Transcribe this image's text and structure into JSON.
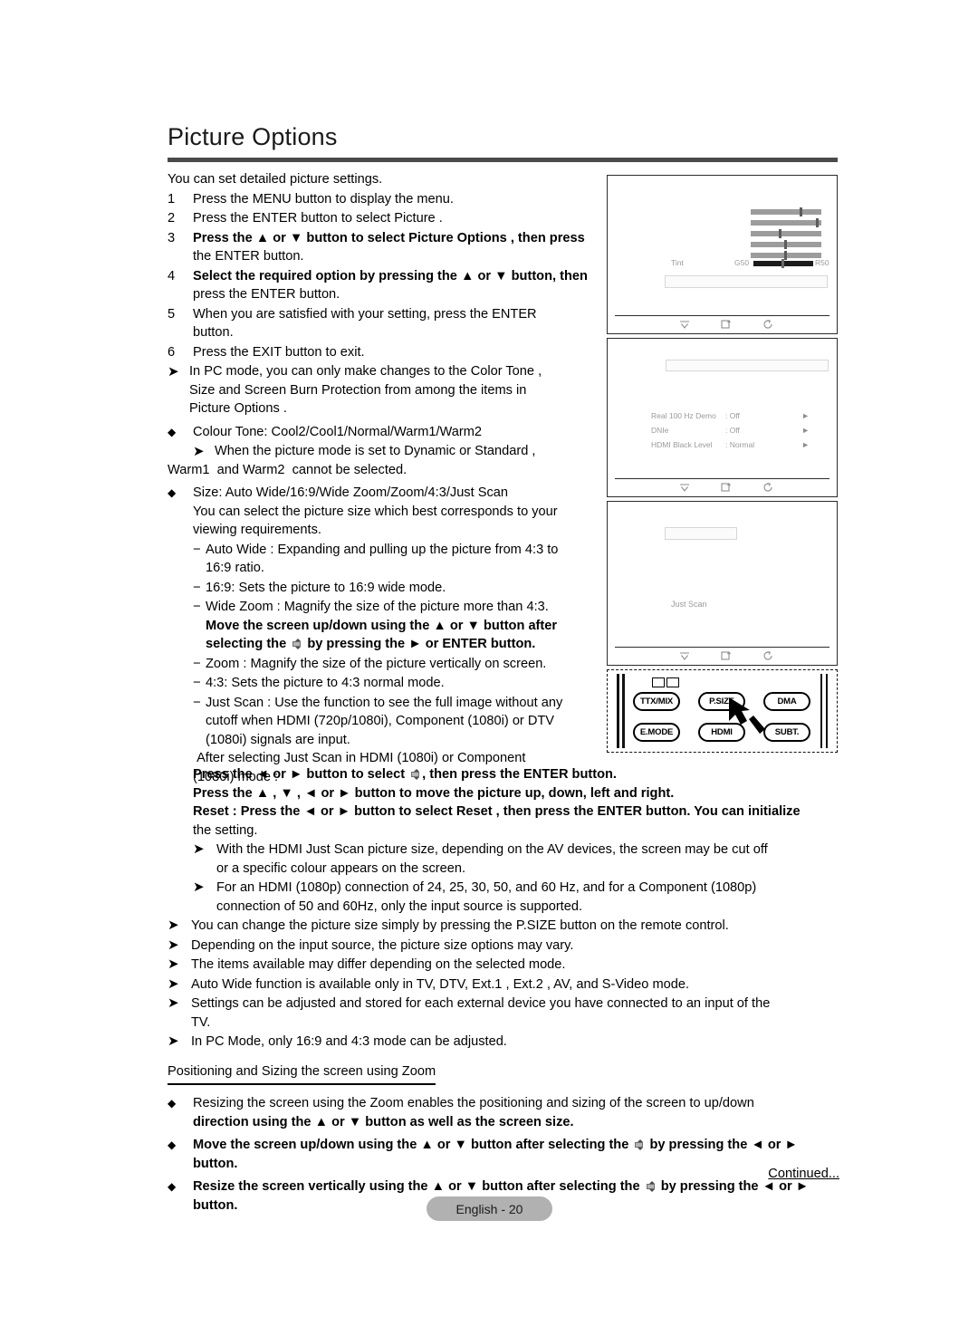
{
  "document": {
    "title": "Picture Options",
    "intro": "You can set detailed picture settings.",
    "footer_label": "English - 20",
    "continued_label": "Continued..."
  },
  "steps": [
    {
      "num": "1",
      "text": "Press the MENU button to display the menu.",
      "bold": false
    },
    {
      "num": "2",
      "text": "Press the ENTER button to select Picture .",
      "bold": false
    },
    {
      "num": "3",
      "text": "Press the ▲ or ▼ button to select Picture Options  , then press",
      "text2": "the ENTER button.",
      "bold": true
    },
    {
      "num": "4",
      "text": "Select the required option by pressing the ▲ or ▼ button, then",
      "text2": "press the ENTER button.",
      "bold": true
    },
    {
      "num": "5",
      "text": "When you are satisfied with your setting, press the ENTER",
      "text2": "button.",
      "bold": false
    },
    {
      "num": "6",
      "text": "Press the EXIT button to exit.",
      "bold": false
    }
  ],
  "notes_top": [
    "In PC mode, you can only make changes to the Color Tone ,",
    "Size and Screen Burn Protection    from among the items in",
    "Picture Options  ."
  ],
  "colour_tone": {
    "bullet": "Colour Tone: Cool2/Cool1/Normal/Warm1/Warm2",
    "note_line1": "When the picture mode is set to Dynamic  or Standard ,",
    "note_line2": "Warm1  and Warm2  cannot be selected."
  },
  "size_section": {
    "bullet": "Size: Auto Wide/16:9/Wide Zoom/Zoom/4:3/Just Scan",
    "desc1": "You can select the picture size which best corresponds to your",
    "desc2": "viewing requirements.",
    "items": [
      {
        "label": "Auto Wide : Expanding and pulling up the picture from 4:3 to",
        "cont": [
          "16:9 ratio."
        ],
        "bold": false
      },
      {
        "label": "16:9: Sets the picture to 16:9 wide mode.",
        "cont": [],
        "bold": false
      },
      {
        "label": "Wide Zoom : Magnify the size of the picture more than 4:3.",
        "cont": [],
        "bold": false
      },
      {
        "label": "Zoom : Magnify the size of the picture vertically on screen.",
        "cont": [],
        "bold": false
      },
      {
        "label": "4:3: Sets the picture to 4:3 normal mode.",
        "cont": [],
        "bold": false
      },
      {
        "label": "Just Scan : Use the function to see the full image without any",
        "cont": [
          "cutoff when HDMI (720p/1080i), Component (1080i) or DTV",
          "(1080i) signals are input."
        ],
        "bold": false
      }
    ],
    "wide_zoom_extra_1": "Move the screen up/down using the ▲ or ▼ button after",
    "wide_zoom_extra_2a": "selecting the ",
    "wide_zoom_extra_2b": " by pressing the ► or ENTER button.",
    "after_just_scan_1": " After selecting Just Scan in HDMI (1080i) or Component",
    "after_just_scan_2": "(1080i) mode :"
  },
  "press_block": {
    "line1a": "Press the ◄ or ► button to select ",
    "line1b": ", then press the ENTER button.",
    "line2": "Press the ▲ , ▼ , ◄ or ► button to move the picture up, down, left and right.",
    "line3a": "Reset : Press the ◄ or ► button to select Reset , then press the ENTER button. You can initialize",
    "line3b": "the setting."
  },
  "notes_mid": [
    {
      "l1": "With the HDMI Just Scan picture size, depending on the AV devices, the screen may be cut off",
      "l2": "or a specific colour appears on the screen."
    },
    {
      "l1": "For an HDMI (1080p) connection of 24, 25, 30, 50, and 60 Hz, and for a Component (1080p)",
      "l2": "connection of 50 and 60Hz, only the input source is supported."
    }
  ],
  "notes_bottom": [
    {
      "l1": "You can change the picture size simply by pressing the P.SIZE button on the remote control.",
      "l2": ""
    },
    {
      "l1": "Depending on the input source, the picture size options may vary.",
      "l2": ""
    },
    {
      "l1": "The items available may differ depending on the selected mode.",
      "l2": ""
    },
    {
      "l1": "Auto Wide  function is available only in TV, DTV, Ext.1 , Ext.2 , AV, and S-Video  mode.",
      "l2": ""
    },
    {
      "l1": "Settings can be adjusted and stored for each external device you have connected to an input of the",
      "l2": "TV."
    },
    {
      "l1": "In PC Mode, only  16:9  and  4:3  mode can be adjusted.",
      "l2": ""
    }
  ],
  "zoom_section": {
    "heading": "Positioning and Sizing the screen using Zoom",
    "items": [
      {
        "l1": "Resizing the screen using the Zoom  enables the positioning and sizing of the screen to up/down",
        "l2": "direction using the ▲ or ▼ button as well as the screen size.",
        "icon": false
      },
      {
        "l1a": "Move the screen up/down using the ▲ or ▼ button after selecting the ",
        "l1b": " by pressing the ◄ or ►",
        "l2": "button.",
        "icon": true
      },
      {
        "l1a": "Resize the screen vertically using the ▲ or ▼ button after selecting the ",
        "l1b": " by pressing the ◄ or ►",
        "l2": "button.",
        "icon": true
      }
    ]
  },
  "osd_panels": [
    {
      "id": "tint-panel",
      "tint_label": "Tint",
      "tint_left": "G50",
      "tint_right": "R50",
      "sliders": [
        {
          "value": 72
        },
        {
          "value": 95
        },
        {
          "value": 41
        },
        {
          "value": 50
        },
        {
          "value": 50
        }
      ],
      "tint_value": 50
    },
    {
      "id": "options-panel",
      "rows": [
        {
          "label": "Real 100 Hz Demo",
          "value": ": Off",
          "arrow": "►"
        },
        {
          "label": "DNIe",
          "value": ": Off",
          "arrow": "►"
        },
        {
          "label": "HDMI Black Level",
          "value": ": Normal",
          "arrow": "►"
        }
      ]
    },
    {
      "id": "size-panel",
      "center_text": "Just Scan"
    }
  ],
  "remote": {
    "buttons": [
      {
        "label": "TTX/MIX"
      },
      {
        "label": "P.SIZE"
      },
      {
        "label": "DMA"
      },
      {
        "label": "E.MODE"
      },
      {
        "label": "HDMI"
      },
      {
        "label": "SUBT."
      }
    ]
  },
  "colors": {
    "rule": "#4a4a4a",
    "footer_pill": "#b1b1b1",
    "osd_border": "#2b2b2b",
    "osd_text": "#9a9a9a",
    "slider_track": "#9c9c9c",
    "slider_track_dark": "#1c1c1c"
  }
}
